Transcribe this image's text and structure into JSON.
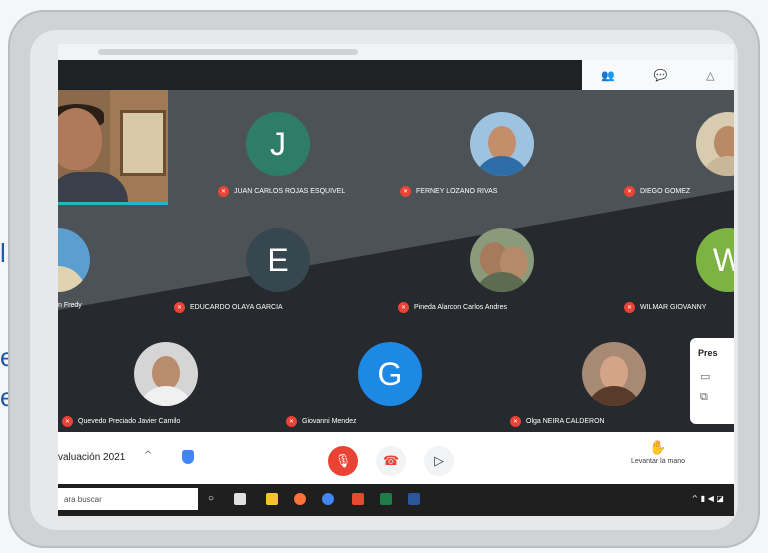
{
  "background_text": [
    "l",
    "ejo",
    "e"
  ],
  "toolbar_icons": [
    "people-icon",
    "chat-icon",
    "activities-icon"
  ],
  "tiles": [
    {
      "name": "JUAN CARLOS ROJAS ESQUIVEL",
      "initial": "J",
      "color": "#2e7d68"
    },
    {
      "name": "FERNEY LOZANO RIVAS",
      "initial": "",
      "color": "#5a7fa8"
    },
    {
      "name": "DIEGO GOMEZ",
      "initial": "",
      "color": "#c9b79a"
    },
    {
      "name": "n Fredy",
      "initial": "",
      "color": "#4a90c0"
    },
    {
      "name": "EDUCARDO OLAYA GARCIA",
      "initial": "E",
      "color": "#37474f"
    },
    {
      "name": "Pineda Alarcon Carlos Andres",
      "initial": "",
      "color": "#7a8a6a"
    },
    {
      "name": "WILMAR GIOVANNY",
      "initial": "W",
      "color": "#7cb342"
    },
    {
      "name": "Quevedo Preciado Javier Camilo",
      "initial": "",
      "color": "#c8c8c8"
    },
    {
      "name": "Giovanni Mendez",
      "initial": "G",
      "color": "#1e88e5"
    },
    {
      "name": "Olga NEIRA CALDERON",
      "initial": "",
      "color": "#8d6e63"
    }
  ],
  "present_panel": {
    "title": "Pres"
  },
  "controls": {
    "meeting_title": "valuación 2021",
    "chevron": "^",
    "mic_button": "mic-off-icon",
    "hangup_button": "hangup-icon",
    "camera_button": "camera-icon",
    "raise_hand_label": "Levantar la mano"
  },
  "taskbar": {
    "search_placeholder": "ara buscar"
  },
  "colors": {
    "mic_off": "#ea4335",
    "accent": "#1db9c3",
    "meet_bg": "#3c4043"
  }
}
